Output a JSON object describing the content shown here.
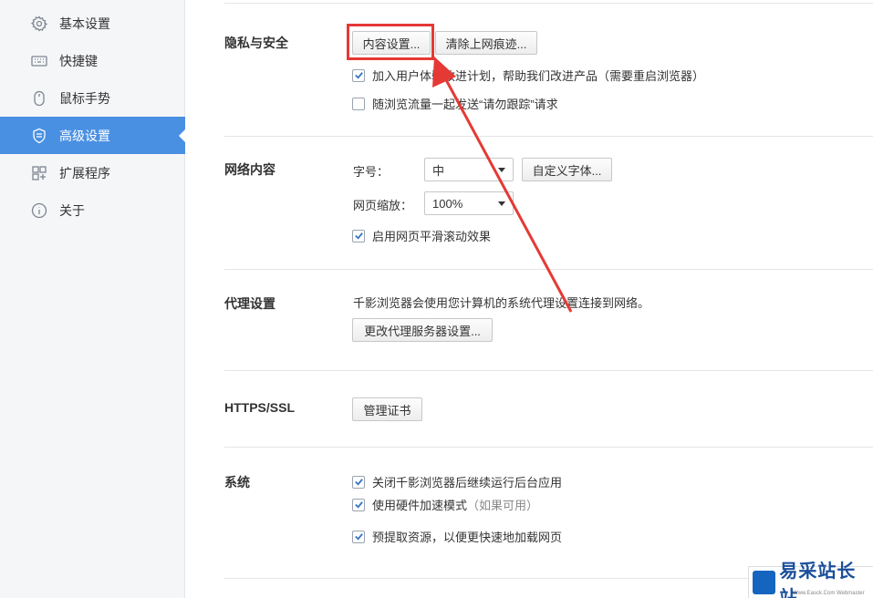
{
  "sidebar": {
    "items": [
      {
        "label": "基本设置",
        "icon": "gear-icon"
      },
      {
        "label": "快捷键",
        "icon": "keyboard-icon"
      },
      {
        "label": "鼠标手势",
        "icon": "mouse-icon"
      },
      {
        "label": "高级设置",
        "icon": "advanced-settings-icon",
        "active": true
      },
      {
        "label": "扩展程序",
        "icon": "extensions-icon"
      },
      {
        "label": "关于",
        "icon": "info-icon"
      }
    ]
  },
  "privacy": {
    "title": "隐私与安全",
    "content_settings_button": "内容设置...",
    "clear_traces_button": "清除上网痕迹...",
    "join_program": {
      "label": "加入用户体验改进计划，帮助我们改进产品（需要重启浏览器）",
      "checked": true
    },
    "do_not_track": {
      "label": "随浏览流量一起发送“请勿跟踪”请求",
      "checked": false
    }
  },
  "web_content": {
    "title": "网络内容",
    "font_size_label": "字号：",
    "font_size_value": "中",
    "custom_fonts_button": "自定义字体...",
    "zoom_label": "网页缩放：",
    "zoom_value": "100%",
    "smooth_scroll": {
      "label": "启用网页平滑滚动效果",
      "checked": true
    }
  },
  "proxy": {
    "title": "代理设置",
    "description": "千影浏览器会使用您计算机的系统代理设置连接到网络。",
    "change_button": "更改代理服务器设置..."
  },
  "https": {
    "title": "HTTPS/SSL",
    "manage_certs_button": "管理证书"
  },
  "system": {
    "title": "系统",
    "background_run": {
      "label": "关闭千影浏览器后继续运行后台应用",
      "checked": true
    },
    "hardware_accel": {
      "label": "使用硬件加速模式",
      "hint": "（如果可用）",
      "checked": true
    },
    "prefetch": {
      "label": "预提取资源，以便更快速地加载网页",
      "checked": true
    }
  },
  "watermark": {
    "text": "易采站长站",
    "sub": "Www.Easck.Com Webmaster"
  },
  "colors": {
    "accent": "#4a90e2",
    "annotation": "#e53935"
  }
}
